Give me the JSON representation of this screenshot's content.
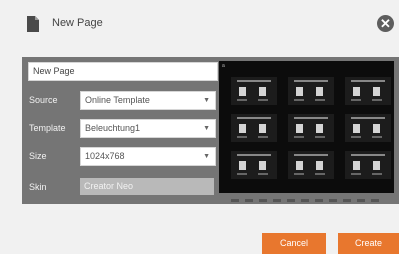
{
  "dialog": {
    "title": "New Page",
    "close_icon": "close-icon",
    "page_icon": "page-icon"
  },
  "form": {
    "name_value": "New Page",
    "source": {
      "label": "Source",
      "value": "Online Template"
    },
    "template": {
      "label": "Template",
      "value": "Beleuchtung1"
    },
    "size": {
      "label": "Size",
      "value": "1024x768"
    },
    "skin": {
      "label": "Skin",
      "value": "Creator Neo"
    }
  },
  "preview": {
    "page_indicator": "a",
    "tile_count": 9
  },
  "buttons": {
    "cancel": "Cancel",
    "create": "Create"
  },
  "colors": {
    "accent": "#e8772e",
    "panel": "#757575",
    "preview_bg": "#0c0c0c"
  }
}
